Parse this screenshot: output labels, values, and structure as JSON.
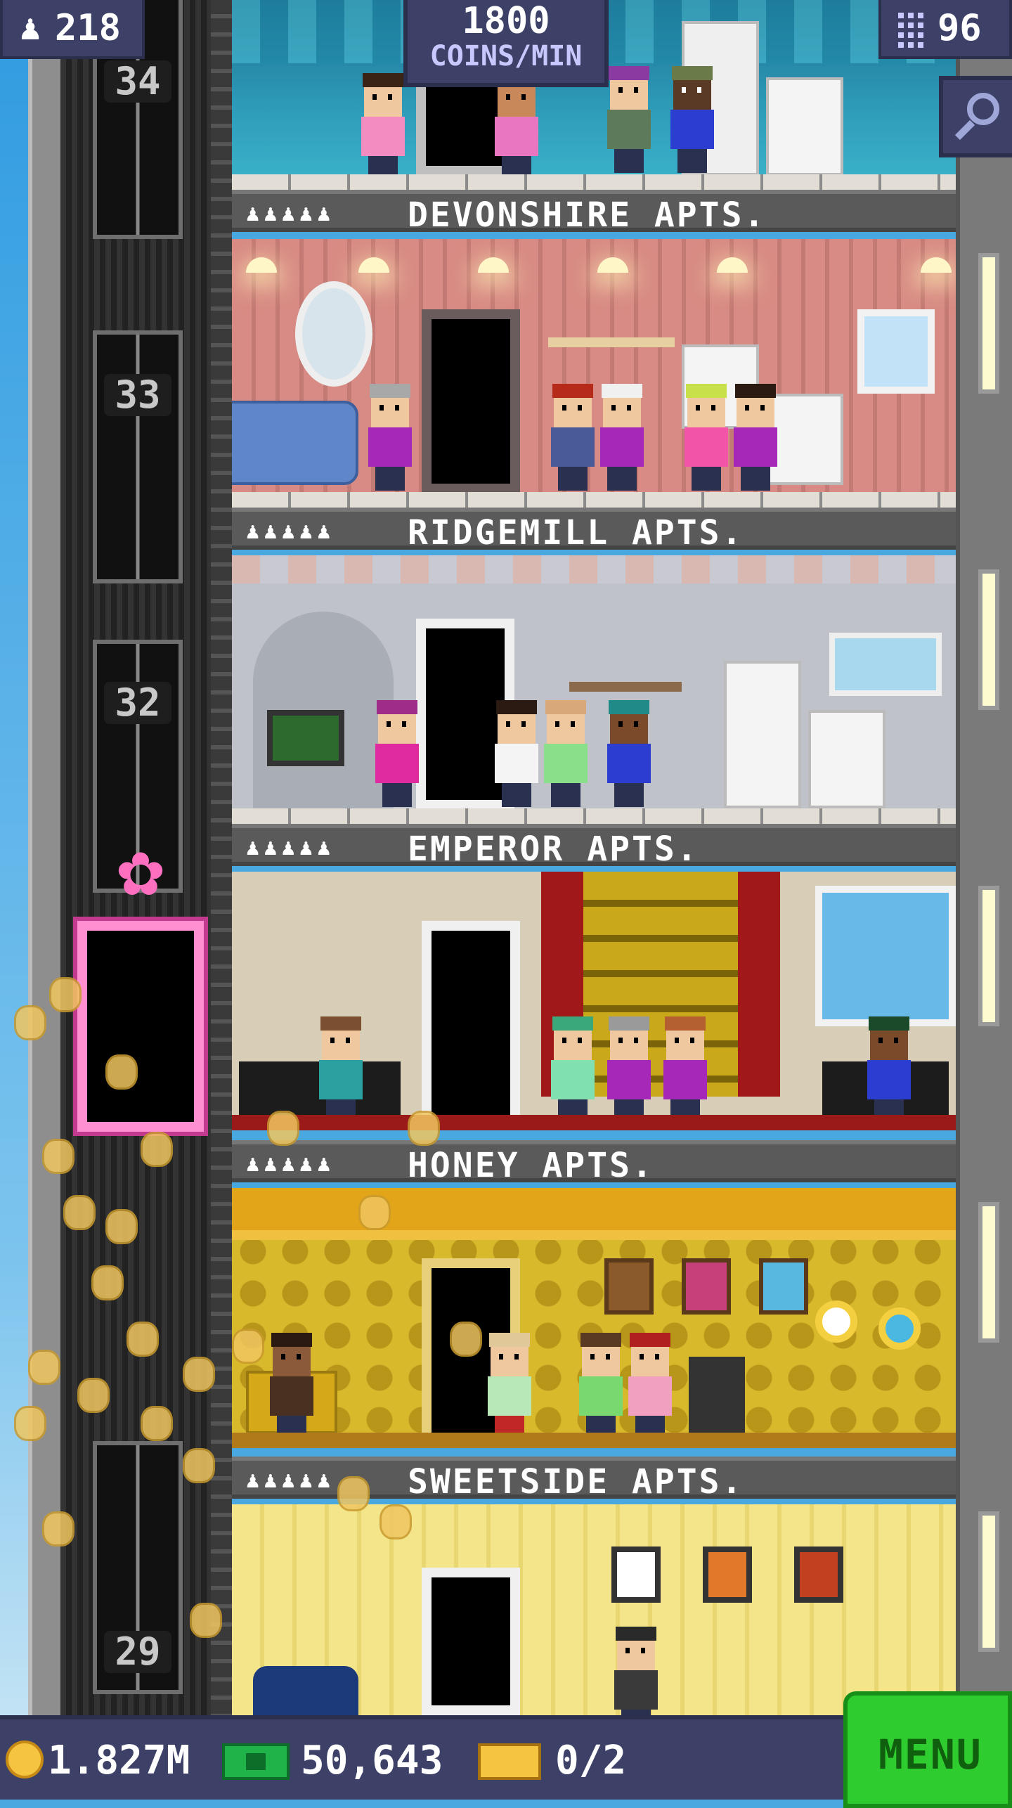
{
  "hud": {
    "residents": "218",
    "coins_per_min_value": "1800",
    "coins_per_min_unit": "COINS/MIN",
    "floors": "96",
    "coins": "1.827M",
    "tower_bux": "50,643",
    "tickets": "0/2",
    "menu_label": "MENU"
  },
  "elevator_floors": [
    "34",
    "33",
    "32",
    "29"
  ],
  "floors": [
    {
      "name": "DEVONSHIRE APTS.",
      "resident_icons": "♟♟♟♟♟"
    },
    {
      "name": "RIDGEMILL APTS.",
      "resident_icons": "♟♟♟♟♟"
    },
    {
      "name": "EMPEROR APTS.",
      "resident_icons": "♟♟♟♟♟"
    },
    {
      "name": "HONEY APTS.",
      "resident_icons": "♟♟♟♟♟"
    },
    {
      "name": "SWEETSIDE APTS.",
      "resident_icons": "♟♟♟♟♟"
    }
  ],
  "icons": {
    "residents": "person-icon",
    "floors": "building-icon",
    "zoom": "magnifier-icon",
    "coins": "coin-icon",
    "bux": "tower-bux-icon",
    "tickets": "vip-ticket-icon"
  },
  "colors": {
    "hud_panel": "#3d4168",
    "menu_button": "#2ecc2e",
    "banner": "#5a5a5a",
    "elevator_accent": "#ff8fd0"
  }
}
